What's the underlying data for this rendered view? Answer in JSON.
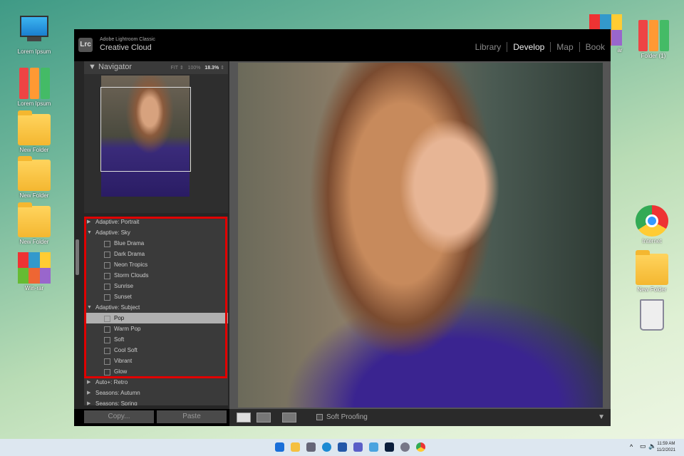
{
  "desktop_left": [
    {
      "label": "Lorem Ipsum",
      "icon": "computer-icon"
    },
    {
      "label": "Lorem Ipsum",
      "icon": "binders-icon"
    },
    {
      "label": "New Folder",
      "icon": "folder-icon"
    },
    {
      "label": "New Folder",
      "icon": "folder-icon"
    },
    {
      "label": "New Folder",
      "icon": "folder-icon"
    },
    {
      "label": "Win-rar",
      "icon": "winrar-icon"
    }
  ],
  "desktop_right": {
    "partial": "ar",
    "folder1": "Folder (1)",
    "internet": "Internet",
    "newfolder": "New Folder"
  },
  "app": {
    "logo": "Lrc",
    "brand_small": "Adobe Lightroom Classic",
    "brand": "Creative Cloud",
    "modules": [
      "Library",
      "Develop",
      "Map",
      "Book"
    ],
    "navigator": {
      "title": "Navigator",
      "fit": "FIT ⇕",
      "p100": "100%",
      "zoom": "18.3%"
    },
    "presets": [
      {
        "t": "g",
        "c": "▶",
        "label": "Adaptive: Portrait"
      },
      {
        "t": "g",
        "c": "▼",
        "label": "Adaptive: Sky"
      },
      {
        "t": "i",
        "label": "Blue Drama"
      },
      {
        "t": "i",
        "label": "Dark Drama"
      },
      {
        "t": "i",
        "label": "Neon Tropics"
      },
      {
        "t": "i",
        "label": "Storm Clouds"
      },
      {
        "t": "i",
        "label": "Sunrise"
      },
      {
        "t": "i",
        "label": "Sunset"
      },
      {
        "t": "g",
        "c": "▼",
        "label": "Adaptive: Subject"
      },
      {
        "t": "i",
        "label": "Pop",
        "sel": true
      },
      {
        "t": "i",
        "label": "Warm Pop"
      },
      {
        "t": "i",
        "label": "Soft"
      },
      {
        "t": "i",
        "label": "Cool Soft"
      },
      {
        "t": "i",
        "label": "Vibrant"
      },
      {
        "t": "i",
        "label": "Glow"
      },
      {
        "t": "g",
        "c": "▶",
        "label": "Auto+: Retro"
      },
      {
        "t": "g",
        "c": "▶",
        "label": "Seasons: Autumn"
      },
      {
        "t": "g",
        "c": "▶",
        "label": "Seasons: Spring"
      }
    ],
    "copy": "Copy...",
    "paste": "Paste",
    "soft_proofing": "Soft Proofing"
  },
  "taskbar": {
    "time": "11:59 AM",
    "date": "11/2/2021"
  }
}
